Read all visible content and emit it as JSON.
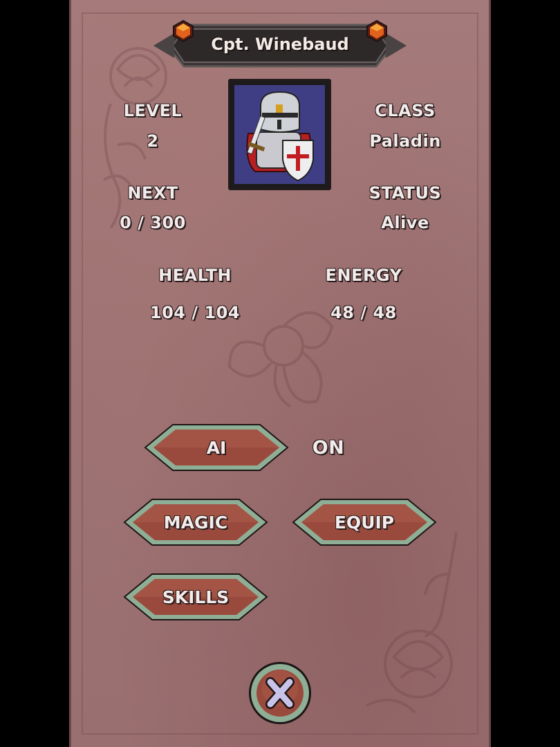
{
  "character": {
    "name": "Cpt. Winebaud"
  },
  "stats": {
    "level_label": "LEVEL",
    "level_value": "2",
    "class_label": "CLASS",
    "class_value": "Paladin",
    "next_label": "NEXT",
    "next_value": "0 / 300",
    "status_label": "STATUS",
    "status_value": "Alive",
    "health_label": "HEALTH",
    "health_value": "104 / 104",
    "energy_label": "ENERGY",
    "energy_value": "48 / 48"
  },
  "buttons": {
    "ai_label": "AI",
    "ai_state": "ON",
    "magic_label": "MAGIC",
    "equip_label": "EQUIP",
    "skills_label": "SKILLS",
    "close_label": "X"
  },
  "colors": {
    "panel": "#a07575",
    "button_face": "#9a4a3c",
    "button_border": "#7fa08a",
    "portrait_bg": "#3f3e85",
    "text": "#f2ebeb"
  },
  "icons": {
    "banner_gem": "orange-gem-icon",
    "portrait": "paladin-knight-portrait",
    "close": "close-x-icon"
  }
}
